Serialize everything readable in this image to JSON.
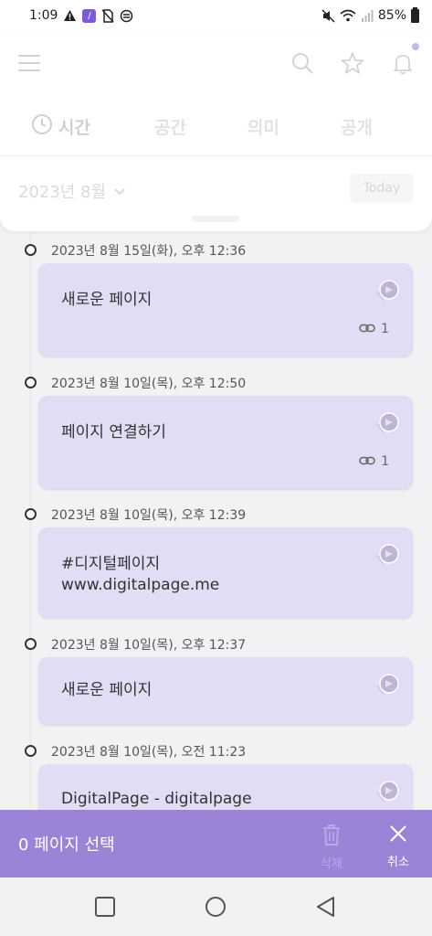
{
  "status": {
    "time": "1:09",
    "battery": "85%"
  },
  "tabs": [
    {
      "label": "시간"
    },
    {
      "label": "공간"
    },
    {
      "label": "의미"
    },
    {
      "label": "공개"
    }
  ],
  "month": {
    "label": "2023년 8월",
    "today_label": "Today"
  },
  "entries": [
    {
      "date": "2023년 8월 15일(화), 오후 12:36",
      "title": "새로운 페이지",
      "subtitle": "",
      "links": "1"
    },
    {
      "date": "2023년 8월 10일(목), 오후 12:50",
      "title": "페이지 연결하기",
      "subtitle": "",
      "links": "1"
    },
    {
      "date": "2023년 8월 10일(목), 오후 12:39",
      "title": "#디지털페이지",
      "subtitle": "www.digitalpage.me",
      "links": ""
    },
    {
      "date": "2023년 8월 10일(목), 오후 12:37",
      "title": "새로운 페이지",
      "subtitle": "",
      "links": ""
    },
    {
      "date": "2023년 8월 10일(목), 오전 11:23",
      "title": "DigitalPage - digitalpage",
      "subtitle": "",
      "links": ""
    }
  ],
  "selection": {
    "count_label": "0 페이지 선택",
    "delete_label": "삭제",
    "cancel_label": "취소"
  },
  "colors": {
    "accent": "#9b84d8",
    "card": "#e2dcf4"
  }
}
